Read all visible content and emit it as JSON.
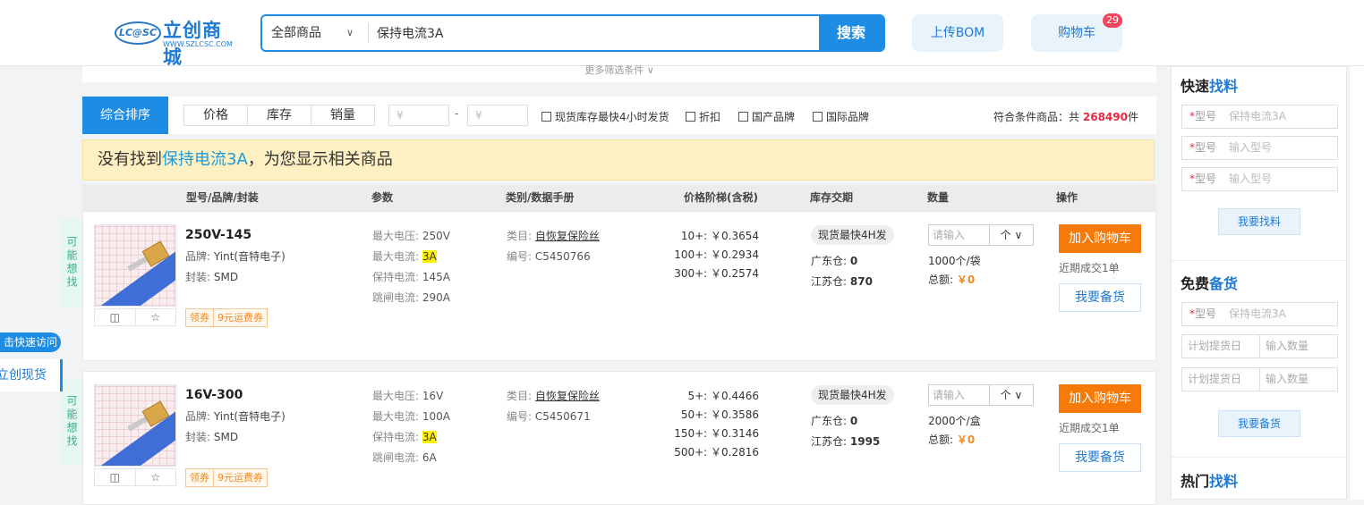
{
  "header": {
    "logo_badge": "LC@SC",
    "logo_name": "立创商城",
    "logo_url": "WWW.SZLCSC.COM",
    "search_category": "全部商品",
    "search_value": "保持电流3A",
    "search_button": "搜索",
    "bom_button": "上传BOM",
    "cart_button": "购物车",
    "cart_count": "29"
  },
  "sidebar": {
    "maybe_label": "可能想找",
    "quick_tab": "击快速访问",
    "quick_link": "立创现货"
  },
  "filter_more": "更多筛选条件",
  "sortbar": {
    "main": "综合排序",
    "tabs": [
      "价格",
      "库存",
      "销量"
    ],
    "price_min_placeholder": "¥",
    "price_dash": "-",
    "price_max_placeholder": "¥",
    "checks": [
      "现货库存最快4小时发货",
      "折扣",
      "国产品牌",
      "国际品牌"
    ],
    "result_prefix": "符合条件商品：共",
    "result_count": "268490",
    "result_suffix": "件"
  },
  "notice": {
    "prefix": "没有找到",
    "keyword": "保持电流3A",
    "suffix": "，为您显示相关商品"
  },
  "table_headers": [
    "型号/品牌/封装",
    "参数",
    "类别/数据手册",
    "价格阶梯(含税)",
    "库存交期",
    "数量",
    "操作"
  ],
  "products": [
    {
      "model": "250V-145",
      "brand_label": "品牌:",
      "brand": "Yint(音特电子)",
      "package_label": "封装:",
      "package": "SMD",
      "coupon_a": "领券",
      "coupon_b": "9元运费券",
      "params": [
        {
          "label": "最大电压:",
          "value": "250V"
        },
        {
          "label": "最大电流:",
          "value": "3A"
        },
        {
          "label": "保持电流:",
          "value": "145A"
        },
        {
          "label": "跳闸电流:",
          "value": "290A"
        }
      ],
      "category_label": "类目:",
      "category": "自恢复保险丝",
      "code_label": "编号:",
      "code": "C5450766",
      "prices": [
        "10+: ￥0.3654",
        "100+: ￥0.2934",
        "300+: ￥0.2574"
      ],
      "stock_tag": "现货最快4H发",
      "stock_gd_label": "广东仓:",
      "stock_gd": "0",
      "stock_js_label": "江苏仓:",
      "stock_js": "870",
      "qty_placeholder": "请输入",
      "qty_unit": "个",
      "pack": "1000个/袋",
      "total_label": "总额:",
      "total": "￥0",
      "add_cart": "加入购物车",
      "recent": "近期成交1单",
      "reserve": "我要备货"
    },
    {
      "model": "16V-300",
      "brand_label": "品牌:",
      "brand": "Yint(音特电子)",
      "package_label": "封装:",
      "package": "SMD",
      "coupon_a": "领券",
      "coupon_b": "9元运费券",
      "params": [
        {
          "label": "最大电压:",
          "value": "16V"
        },
        {
          "label": "最大电流:",
          "value": "100A"
        },
        {
          "label": "保持电流:",
          "value": "3A"
        },
        {
          "label": "跳闸电流:",
          "value": "6A"
        }
      ],
      "category_label": "类目:",
      "category": "自恢复保险丝",
      "code_label": "编号:",
      "code": "C5450671",
      "prices": [
        "5+: ￥0.4466",
        "50+: ￥0.3586",
        "150+: ￥0.3146",
        "500+: ￥0.2816"
      ],
      "stock_tag": "现货最快4H发",
      "stock_gd_label": "广东仓:",
      "stock_gd": "0",
      "stock_js_label": "江苏仓:",
      "stock_js": "1995",
      "qty_placeholder": "请输入",
      "qty_unit": "个",
      "pack": "2000个/盒",
      "total_label": "总额:",
      "total": "￥0",
      "add_cart": "加入购物车",
      "recent": "近期成交1单",
      "reserve": "我要备货"
    }
  ],
  "right_panel": {
    "quick_title_a": "快速",
    "quick_title_b": "找料",
    "req_mark": "*",
    "model_label": "型号",
    "model_value": "保持电流3A",
    "model_placeholder": "输入型号",
    "find_button": "我要找料",
    "stock_title_a": "免费",
    "stock_title_b": "备货",
    "date_placeholder": "计划提货日",
    "qty_placeholder": "输入数量",
    "stock_button": "我要备货",
    "hot_title_a": "热门",
    "hot_title_b": "找料"
  }
}
